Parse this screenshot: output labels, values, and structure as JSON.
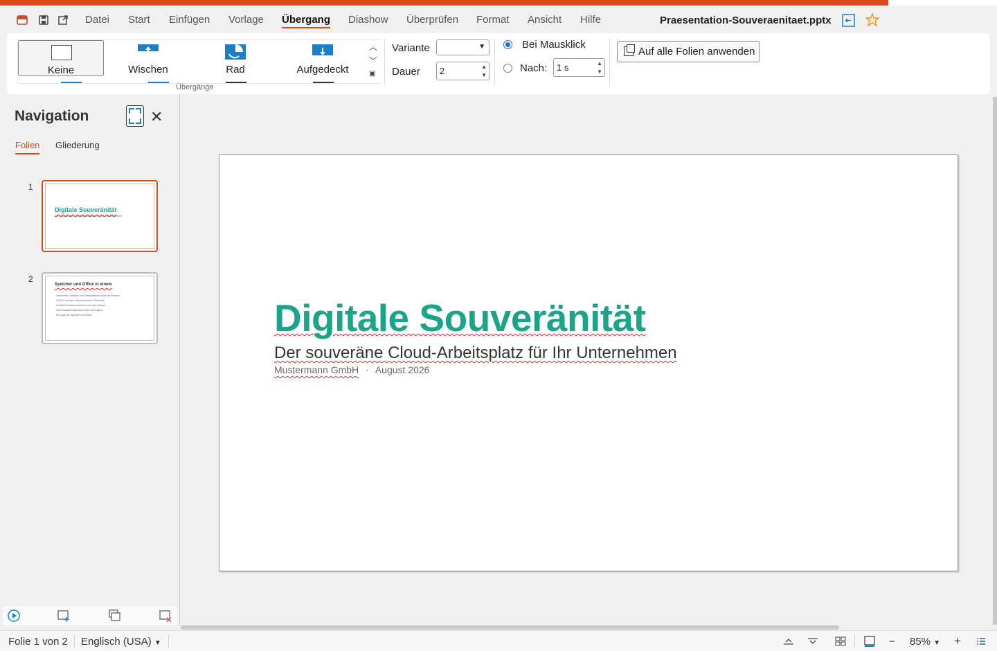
{
  "menu": {
    "items": [
      "Datei",
      "Start",
      "Einfügen",
      "Vorlage",
      "Übergang",
      "Diashow",
      "Überprüfen",
      "Format",
      "Ansicht",
      "Hilfe"
    ],
    "active": "Übergang",
    "doc_title": "Praesentation-Souveraenitaet.pptx"
  },
  "ribbon": {
    "transitions": [
      "Keine",
      "Wischen",
      "Rad",
      "Aufgedeckt"
    ],
    "selected_transition": "Keine",
    "group_label": "Übergänge",
    "variant_label": "Variante",
    "variant_value": "",
    "duration_label": "Dauer",
    "duration_value": "2",
    "on_click_label": "Bei Mausklick",
    "after_label": "Nach:",
    "after_value": "1 s",
    "apply_all_label": "Auf alle Folien anwenden"
  },
  "navigation": {
    "title": "Navigation",
    "tabs": [
      "Folien",
      "Gliederung"
    ],
    "active_tab": "Folien",
    "slides": [
      {
        "number": "1",
        "title": "Digitale Souveränität",
        "subtitle": "Der souveräne Cloud-Arbeitsplatz für Ihr Unternehmen"
      },
      {
        "number": "2",
        "title": "Speicher und Office in einem",
        "bullets": [
          "Dokumente, Tabellen und Präsentationen direkt im Browser",
          "DSGVO-konform, Rechenzentrum Österreich",
          "Echtzeit-Zusammenarbeit immer aktiv Version",
          "Kein Installationsaufwand, kein OS-Support",
          "Ein Login für Speicher und Office"
        ]
      }
    ]
  },
  "slide": {
    "title": "Digitale Souveränität",
    "subtitle": "Der souveräne Cloud-Arbeitsplatz für Ihr Unternehmen",
    "company": "Mustermann GmbH",
    "separator": "·",
    "date": "August 2026"
  },
  "status": {
    "slide_info": "Folie 1 von 2",
    "language": "Englisch (USA)",
    "zoom": "85%"
  },
  "colors": {
    "accent": "#d64a1e",
    "title_teal": "#1aa58a"
  }
}
